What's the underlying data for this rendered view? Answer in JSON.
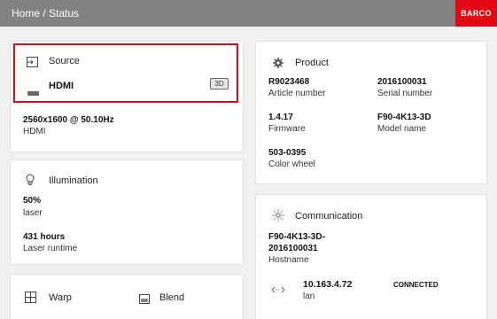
{
  "header": {
    "breadcrumb": "Home / Status",
    "logo_text": "BARCO"
  },
  "source": {
    "title": "Source",
    "input_name": "HDMI",
    "badge": "3D",
    "resolution": "2560x1600 @ 50.10Hz",
    "resolution_label": "HDMI"
  },
  "illumination": {
    "title": "Illumination",
    "level_value": "50%",
    "level_label": "laser",
    "runtime_value": "431 hours",
    "runtime_label": "Laser runtime"
  },
  "tools": {
    "warp_label": "Warp",
    "blend_label": "Blend"
  },
  "product": {
    "title": "Product",
    "article_value": "R9023468",
    "article_label": "Article number",
    "serial_value": "2016100031",
    "serial_label": "Serial number",
    "firmware_value": "1.4.17",
    "firmware_label": "Firmware",
    "model_value": "F90-4K13-3D",
    "model_label": "Model name",
    "wheel_value": "503-0395",
    "wheel_label": "Color wheel"
  },
  "communication": {
    "title": "Communication",
    "hostname_line1": "F90-4K13-3D-",
    "hostname_line2": "2016100031",
    "hostname_label": "Hostname",
    "ip_value": "10.163.4.72",
    "ip_label": "lan",
    "status": "CONNECTED"
  },
  "colors": {
    "accent": "#e30613",
    "header": "#828282"
  }
}
